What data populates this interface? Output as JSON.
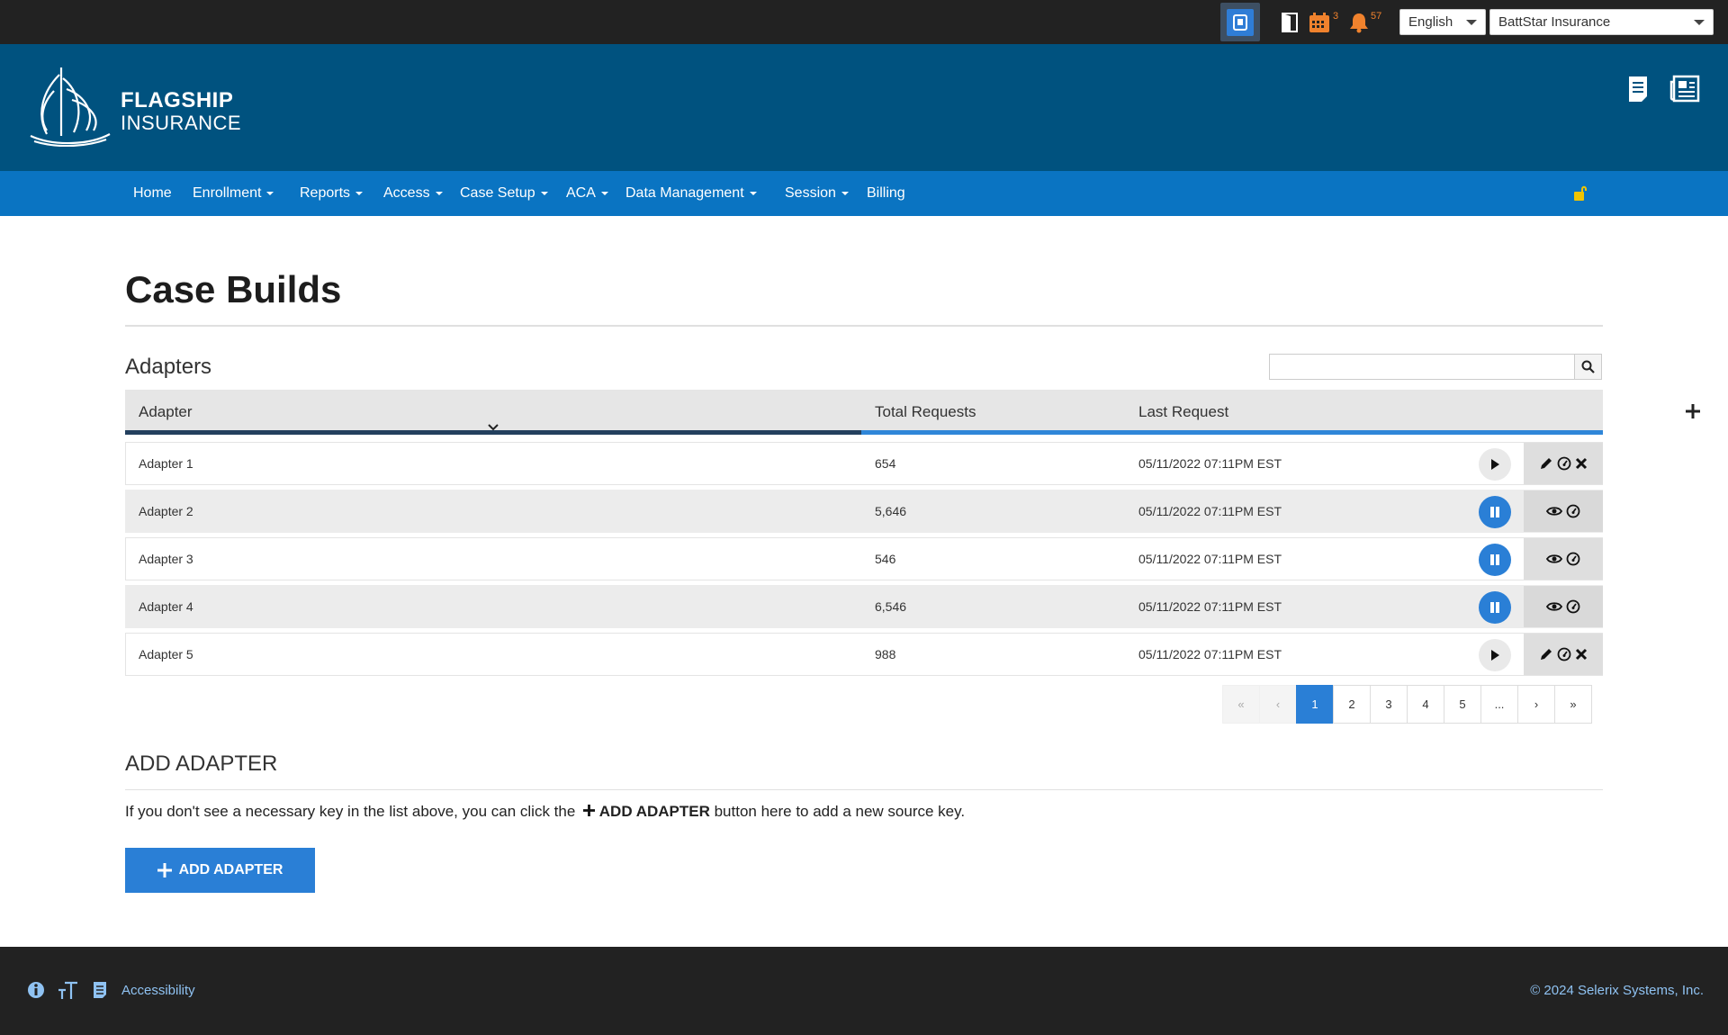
{
  "topbar": {
    "calendar_badge": "3",
    "notifications_badge": "57",
    "language": "English",
    "company": "BattStar Insurance"
  },
  "brand": {
    "line1": "FLAGSHIP",
    "line2": "INSURANCE"
  },
  "nav": {
    "items": [
      "Home",
      "Enrollment",
      "Reports",
      "Access",
      "Case Setup",
      "ACA",
      "Data Management",
      "Session",
      "Billing"
    ]
  },
  "page": {
    "title": "Case Builds",
    "adapters_heading": "Adapters",
    "search_placeholder": ""
  },
  "table": {
    "columns": [
      "Adapter",
      "Total Requests",
      "Last Request"
    ],
    "rows": [
      {
        "name": "Adapter 1",
        "requests": "654",
        "last": "05/11/2022 07:11PM EST",
        "state": "paused",
        "actions": [
          "edit",
          "dashboard",
          "delete"
        ]
      },
      {
        "name": "Adapter 2",
        "requests": "5,646",
        "last": "05/11/2022 07:11PM EST",
        "state": "running",
        "actions": [
          "view",
          "dashboard"
        ]
      },
      {
        "name": "Adapter 3",
        "requests": "546",
        "last": "05/11/2022 07:11PM EST",
        "state": "running",
        "actions": [
          "view",
          "dashboard"
        ]
      },
      {
        "name": "Adapter 4",
        "requests": "6,546",
        "last": "05/11/2022 07:11PM EST",
        "state": "running",
        "actions": [
          "view",
          "dashboard"
        ]
      },
      {
        "name": "Adapter 5",
        "requests": "988",
        "last": "05/11/2022 07:11PM EST",
        "state": "paused",
        "actions": [
          "edit",
          "dashboard",
          "delete"
        ]
      }
    ]
  },
  "pagination": {
    "first": "«",
    "prev": "‹",
    "pages": [
      "1",
      "2",
      "3",
      "4",
      "5"
    ],
    "ellipsis": "...",
    "next": "›",
    "last": "»",
    "current": "1"
  },
  "add_section": {
    "heading": "ADD ADAPTER",
    "desc_before": "If you don't see a necessary key in the list above, you can click the",
    "desc_bold": "ADD ADAPTER",
    "desc_after": "button here to add a new source key.",
    "button_label": "ADD ADAPTER"
  },
  "footer": {
    "accessibility": "Accessibility",
    "copyright": "© 2024 Selerix Systems, Inc."
  },
  "colors": {
    "topbar": "#222222",
    "brand": "#00527f",
    "nav": "#0a74c2",
    "accent": "#2a7fd6",
    "badge": "#f0822d"
  }
}
